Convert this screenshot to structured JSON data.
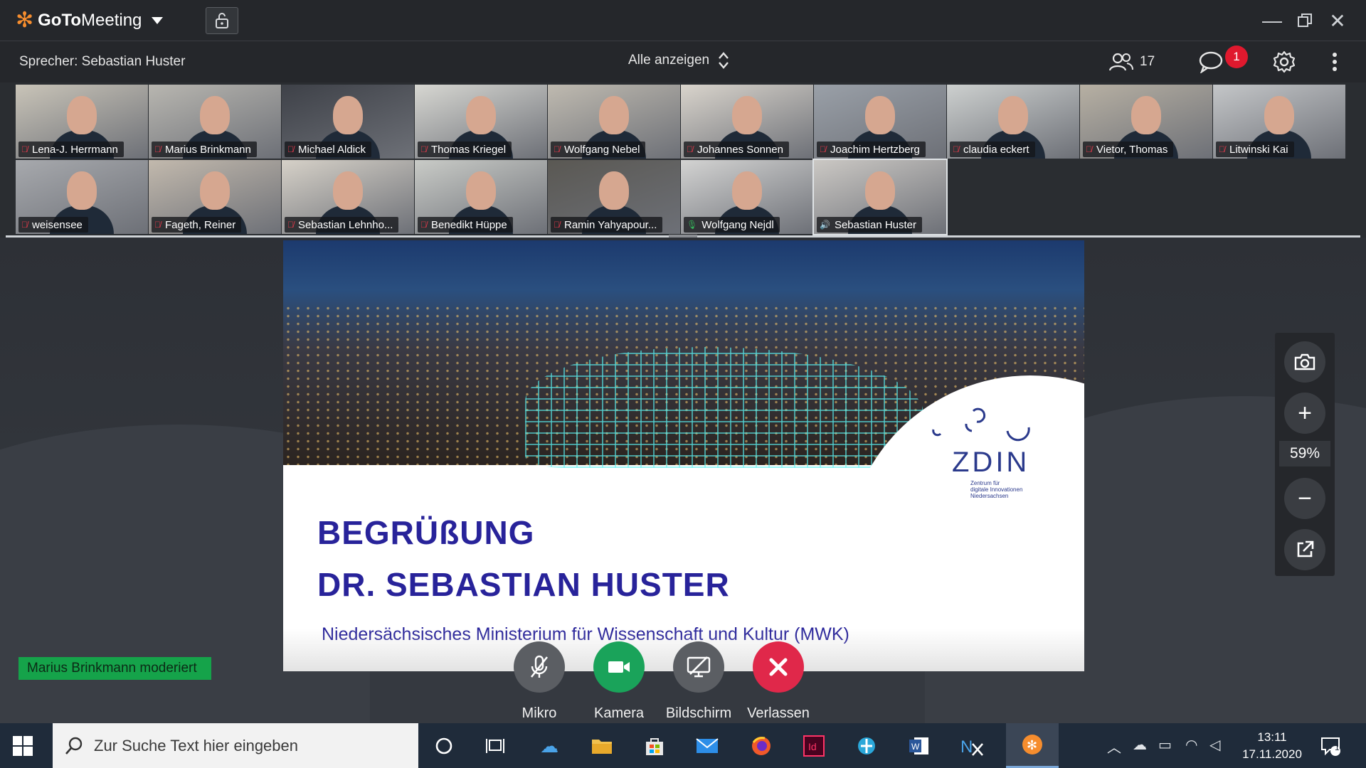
{
  "app": {
    "brand": "GoToMeeting",
    "brand_bold": "GoTo",
    "brand_light": "Meeting",
    "accent_color": "#f68d2e"
  },
  "header": {
    "speaker": "Sprecher: Sebastian Huster",
    "show_all": "Alle anzeigen",
    "attendee_count": "17",
    "chat_badge": "1"
  },
  "participants": [
    {
      "name": "Lena-J. Herrmann",
      "mic": "off"
    },
    {
      "name": "Marius Brinkmann",
      "mic": "off"
    },
    {
      "name": "Michael Aldick",
      "mic": "off"
    },
    {
      "name": "Thomas Kriegel",
      "mic": "off"
    },
    {
      "name": "Wolfgang Nebel",
      "mic": "off"
    },
    {
      "name": "Johannes Sonnen",
      "mic": "off"
    },
    {
      "name": "Joachim Hertzberg",
      "mic": "off"
    },
    {
      "name": "claudia eckert",
      "mic": "off"
    },
    {
      "name": "Vietor, Thomas",
      "mic": "off"
    },
    {
      "name": "Litwinski Kai",
      "mic": "off"
    },
    {
      "name": "weisensee",
      "mic": "off"
    },
    {
      "name": "Fageth, Reiner",
      "mic": "off"
    },
    {
      "name": "Sebastian Lehnho...",
      "mic": "off"
    },
    {
      "name": "Benedikt Hüppe",
      "mic": "off"
    },
    {
      "name": "Ramin Yahyapour...",
      "mic": "off"
    },
    {
      "name": "Wolfgang Nejdl",
      "mic": "on"
    },
    {
      "name": "Sebastian Huster",
      "mic": "speaking"
    }
  ],
  "slide": {
    "logo_text": "ZDIN",
    "logo_sub_1": "Zentrum für",
    "logo_sub_2": "digitale Innovationen",
    "logo_sub_3": "Niedersachsen",
    "heading_1": "BEGRÜßUNG",
    "heading_2": "DR. SEBASTIAN HUSTER",
    "subtitle": "Niedersächsisches Ministerium für Wissenschaft und Kultur (MWK)",
    "text_color": "#28239a"
  },
  "zoom": {
    "level": "59%"
  },
  "moderator_tag": "Marius Brinkmann moderiert",
  "controls": {
    "mic": "Mikro",
    "camera": "Kamera",
    "screen": "Bildschirm",
    "leave": "Verlassen"
  },
  "taskbar": {
    "search_placeholder": "Zur Suche Text hier eingeben",
    "time": "13:11",
    "date": "17.11.2020",
    "notification_count": "1"
  }
}
